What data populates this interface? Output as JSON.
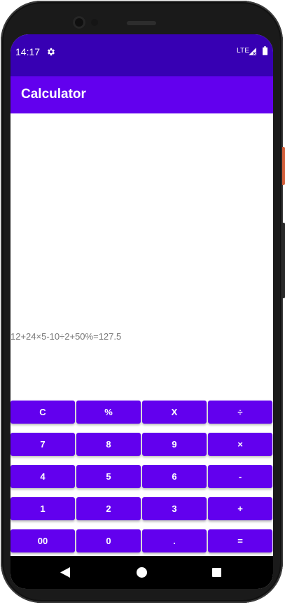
{
  "status_bar": {
    "time": "14:17",
    "settings_icon": "gear-icon",
    "network": "LTE",
    "signal_icon": "signal-icon",
    "battery_icon": "battery-icon"
  },
  "app_bar": {
    "title": "Calculator"
  },
  "display": {
    "expression": "12+24×5-10÷2+50%=127.5"
  },
  "keypad": {
    "rows": [
      [
        "C",
        "%",
        "X",
        "÷"
      ],
      [
        "7",
        "8",
        "9",
        "×"
      ],
      [
        "4",
        "5",
        "6",
        "-"
      ],
      [
        "1",
        "2",
        "3",
        "+"
      ],
      [
        "00",
        "0",
        ".",
        "="
      ]
    ]
  },
  "nav_bar": {
    "back_icon": "back-triangle-icon",
    "home_icon": "home-circle-icon",
    "recents_icon": "recents-square-icon"
  },
  "colors": {
    "status_bar": "#3700b3",
    "primary": "#6200ee",
    "display_text": "#777777"
  }
}
